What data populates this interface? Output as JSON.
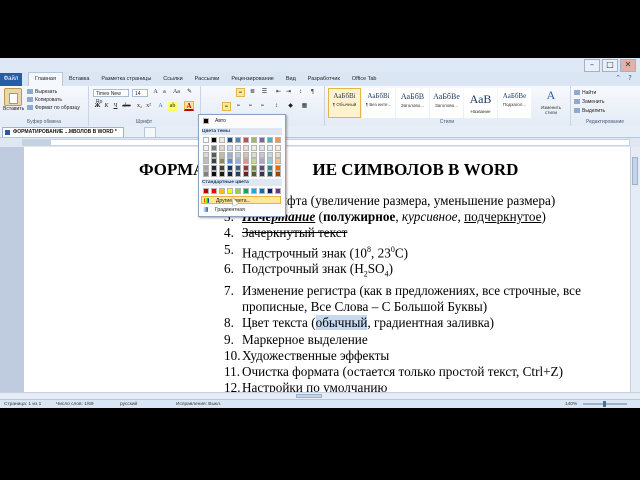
{
  "window": {
    "file_tab": "Файл",
    "tabs": [
      "Главная",
      "Вставка",
      "Разметка страницы",
      "Ссылки",
      "Рассылки",
      "Рецензирование",
      "Вид",
      "Разработчик",
      "Office Tab"
    ],
    "active_tab": "Главная",
    "controls": [
      "–",
      "□",
      "✕"
    ]
  },
  "ribbon": {
    "clipboard": {
      "paste_label": "Вставить",
      "cut": "Вырезать",
      "copy": "Копировать",
      "format_painter": "Формат по образцу",
      "group_label": "Буфер обмена"
    },
    "font": {
      "font_name": "Times New Ro",
      "font_size": "14",
      "group_label": "Шрифт"
    },
    "styles": {
      "items": [
        {
          "sample": "АаБбВі",
          "name": "¶ Обычный",
          "selected": true
        },
        {
          "sample": "АаБбВі",
          "name": "¶ Без инте...",
          "selected": false
        },
        {
          "sample": "АаБбВ",
          "name": "Заголово...",
          "selected": false
        },
        {
          "sample": "АаБбВе",
          "name": "Заголово...",
          "selected": false
        },
        {
          "sample": "АаВ",
          "name": "Название",
          "selected": false
        },
        {
          "sample": "АаБбВе",
          "name": "Подзагол...",
          "selected": false
        }
      ],
      "change_styles": "Изменить стили",
      "group_label": "Стили"
    },
    "editing": {
      "find": "Найти",
      "replace": "Заменить",
      "select": "Выделить",
      "group_label": "Редактирование"
    }
  },
  "doc_tab": {
    "title": "ФОРМАТИРОВАНИЕ ...МВОЛОВ В WORD *"
  },
  "color_menu": {
    "auto_label": "Авто",
    "theme_label": "Цвета темы",
    "standard_label": "Стандартные цвета",
    "more_colors": "Другие цвета...",
    "gradient": "Градиентная",
    "theme_top_row": [
      "#FFFFFF",
      "#000000",
      "#EEECE1",
      "#1F497D",
      "#4F81BD",
      "#C0504D",
      "#9BBB59",
      "#8064A2",
      "#4BACC6",
      "#F79646"
    ],
    "theme_shades": [
      [
        "#F2F2F2",
        "#7F7F7F",
        "#DDD9C3",
        "#C6D9F0",
        "#DBE5F1",
        "#F2DCDB",
        "#EBF1DD",
        "#E5E0EC",
        "#DBEEF3",
        "#FDEADA"
      ],
      [
        "#D8D8D8",
        "#595959",
        "#C4BD97",
        "#8DB3E2",
        "#B8CCE4",
        "#E5B9B7",
        "#D7E3BC",
        "#CCC1D9",
        "#B7DDE8",
        "#FBD5B5"
      ],
      [
        "#BFBFBF",
        "#3F3F3F",
        "#938953",
        "#548DD4",
        "#95B3D7",
        "#D99694",
        "#C3D69B",
        "#B2A2C7",
        "#92CDDC",
        "#FAC08F"
      ],
      [
        "#A5A5A5",
        "#262626",
        "#494429",
        "#17365D",
        "#366092",
        "#953734",
        "#76923C",
        "#5F497A",
        "#31859B",
        "#E36C09"
      ],
      [
        "#7F7F7F",
        "#0C0C0C",
        "#1D1B10",
        "#0F243E",
        "#244061",
        "#632423",
        "#4F6128",
        "#3F3151",
        "#205867",
        "#974806"
      ]
    ],
    "standard": [
      "#C00000",
      "#FF0000",
      "#FFC000",
      "#FFFF00",
      "#92D050",
      "#00B050",
      "#00B0F0",
      "#0070C0",
      "#002060",
      "#7030A0"
    ]
  },
  "document": {
    "title_left": "ФОРМАТИ",
    "title_right": "ИЕ СИМВОЛОВ В WORD",
    "items": [
      {
        "num": "",
        "text_plain": "ифта (увеличение размера, уменьшение размера)"
      },
      {
        "num": "3.",
        "text_bold_italic_under": "Начертание",
        "text_rest_a": " (",
        "text_bold": "полужирное",
        "text_rest_b": ", ",
        "text_italic": "курсивное",
        "text_rest_c": ", ",
        "text_under": "подчеркнутое",
        "text_rest_d": ")"
      },
      {
        "num": "4.",
        "text_strike": "Зачеркнутый текст"
      },
      {
        "num": "5.",
        "text_plain": "Надстрочный знак (10",
        "sup1": "8",
        "text_mid": ", 23",
        "sup2": "0",
        "text_end": "С)"
      },
      {
        "num": "6.",
        "text_plain": "Подстрочный знак (H",
        "sub1": "2",
        "text_mid": "SO",
        "sub2": "4",
        "text_end": ")"
      },
      {
        "num": "7.",
        "text_plain": "Изменение регистра (как в предложениях, все строчные, все прописные, Все Слова – С Большой Буквы)"
      },
      {
        "num": "8.",
        "text_plain": "Цвет текста (",
        "text_selected": "обычный",
        "text_end": ", градиентная заливка)"
      },
      {
        "num": "9.",
        "text_plain": "Маркерное выделение"
      },
      {
        "num": "10.",
        "text_plain": "Художественные эффекты"
      },
      {
        "num": "11.",
        "text_plain": "Очистка формата (остается только простой текст, Ctrl+Z)"
      },
      {
        "num": "12.",
        "text_plain": "Настройки по умолчанию"
      }
    ]
  },
  "status": {
    "page": "Страница: 1 из 1",
    "words": "Число слов: 1/69",
    "lang": "русский",
    "track": "Исправления: Выкл.",
    "zoom": "140%"
  }
}
